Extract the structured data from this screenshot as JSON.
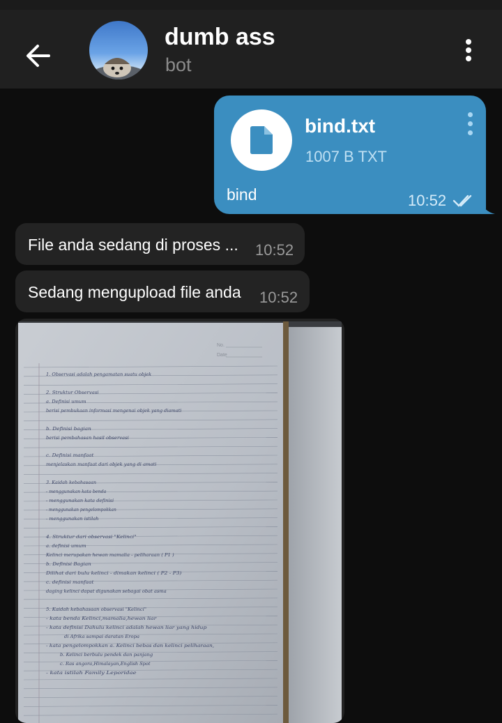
{
  "header": {
    "title": "dumb ass",
    "subtitle": "bot"
  },
  "messages": {
    "outgoing_file": {
      "file_name": "bind.txt",
      "file_meta": "1007 B TXT",
      "caption": "bind",
      "time": "10:52",
      "status": "read"
    },
    "incoming": [
      {
        "text": "File anda sedang di proses ...",
        "time": "10:52"
      },
      {
        "text": "Sedang mengupload file anda",
        "time": "10:52"
      }
    ],
    "photo": {
      "handwriting": [
        "1. Observasi adalah pengamatan suatu objek",
        "2. Struktur Observasi",
        "a. Definisi umum",
        "berisi pembukaan informasi mengenai objek yang diamati",
        "b. Definisi bagian",
        "berisi pembahasan hasil observasi",
        "c. Definisi manfaat",
        "menjelaskan manfaat dari objek yang di amati",
        "3. Kaidah kebahasaan",
        "- menggunakan kata benda",
        "- menggunakan kata definisi",
        "- menggunakan pengelompokkan",
        "- menggunakan istilah",
        "4. Struktur dari observasi \"Kelinci\"",
        "a. definisi umum",
        "Kelinci merupakan hewan mamalia - peliharaan ( P1 )",
        "b. Definisi Bagian",
        "Dilihat dari bulu kelinci - dimakan kelinci ( P2 - P3)",
        "c. definisi manfaat",
        "daging kelinci dapat digunakan sebagai obat asma",
        "5. Kaidah kebahasaan observasi \"Kelinci\"",
        "- kata benda      Kelinci,mamalia,hewan liar",
        "- kata definisi      Dahulu kelinci adalah hewan liar yang hidup",
        "di Afrika sampai daratan Eropa",
        "- kata pengelompokkan      a. Kelinci bebas dan kelinci peliharaan,",
        "b. Kelinci berbulu pendek dan panjang",
        "c. Ras angora,Himalayan,English Spot",
        "- kata istilah      Family Leporidae"
      ]
    }
  },
  "colors": {
    "background": "#0d0d0d",
    "header": "#202020",
    "outgoing_bubble": "#3b8ec0",
    "incoming_bubble": "#232323"
  },
  "icons": {
    "back": "arrow-left-icon",
    "menu": "more-vertical-icon",
    "file": "document-icon",
    "read": "double-check-icon"
  }
}
